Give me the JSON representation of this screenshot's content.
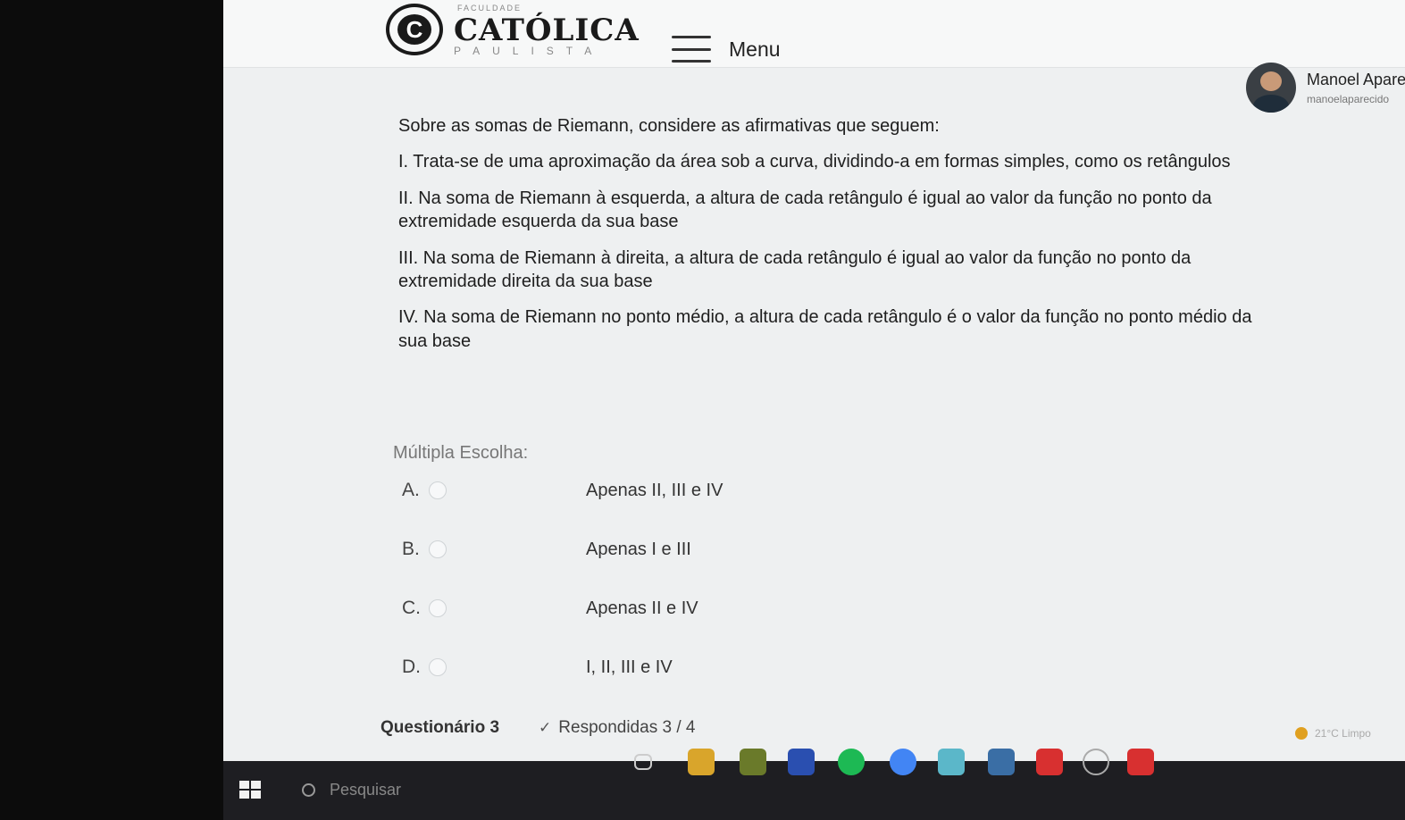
{
  "header": {
    "logo_small": "FACULDADE",
    "logo_name": "CATÓLICA",
    "logo_sub": "PAULISTA",
    "menu_label": "Menu"
  },
  "user": {
    "name": "Manoel Apare",
    "email": "manoelaparecido"
  },
  "question": {
    "intro": "Sobre as somas de Riemann, considere as afirmativas que seguem:",
    "items": [
      "I. Trata-se de uma aproximação da área sob a curva, dividindo-a em formas simples, como os retângulos",
      "II. Na soma de Riemann à esquerda, a altura de cada retângulo é igual ao valor da função no ponto da extremidade esquerda da sua base",
      "III. Na soma de Riemann à direita, a altura de cada retângulo é igual ao valor da função no ponto da extremidade direita da sua base",
      "IV. Na soma de Riemann no ponto médio, a altura de cada retângulo é o valor da função no ponto médio da sua base"
    ]
  },
  "multiple_choice": {
    "label": "Múltipla Escolha:",
    "options": [
      {
        "letter": "A.",
        "text": "Apenas II, III e IV"
      },
      {
        "letter": "B.",
        "text": "Apenas I e III"
      },
      {
        "letter": "C.",
        "text": "Apenas II e IV"
      },
      {
        "letter": "D.",
        "text": "I, II, III e IV"
      }
    ]
  },
  "footer": {
    "quiz_name": "Questionário 3",
    "answered": "Respondidas 3 / 4"
  },
  "taskbar": {
    "search_placeholder": "Pesquisar",
    "weather": "21°C Limpo"
  },
  "colors": {
    "page_bg": "#eef0f1",
    "taskbar_bg": "#1e1e22"
  }
}
